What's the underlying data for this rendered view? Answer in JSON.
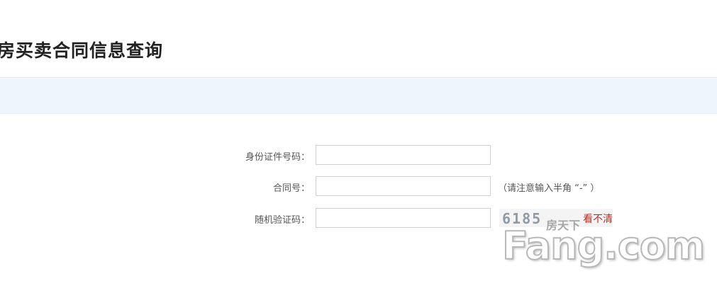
{
  "page": {
    "title": "房买卖合同信息查询"
  },
  "form": {
    "id_number": {
      "label": "身份证件号码：",
      "value": "",
      "placeholder": ""
    },
    "contract_number": {
      "label": "合同号：",
      "value": "",
      "placeholder": "",
      "hint": "（请注意输入半角 “-” ）"
    },
    "captcha": {
      "label": "随机验证码：",
      "value": "",
      "placeholder": "",
      "code": "6185",
      "refresh_label": "看不清"
    }
  },
  "watermark": {
    "cn": "房天下",
    "text": "Fang.com"
  }
}
